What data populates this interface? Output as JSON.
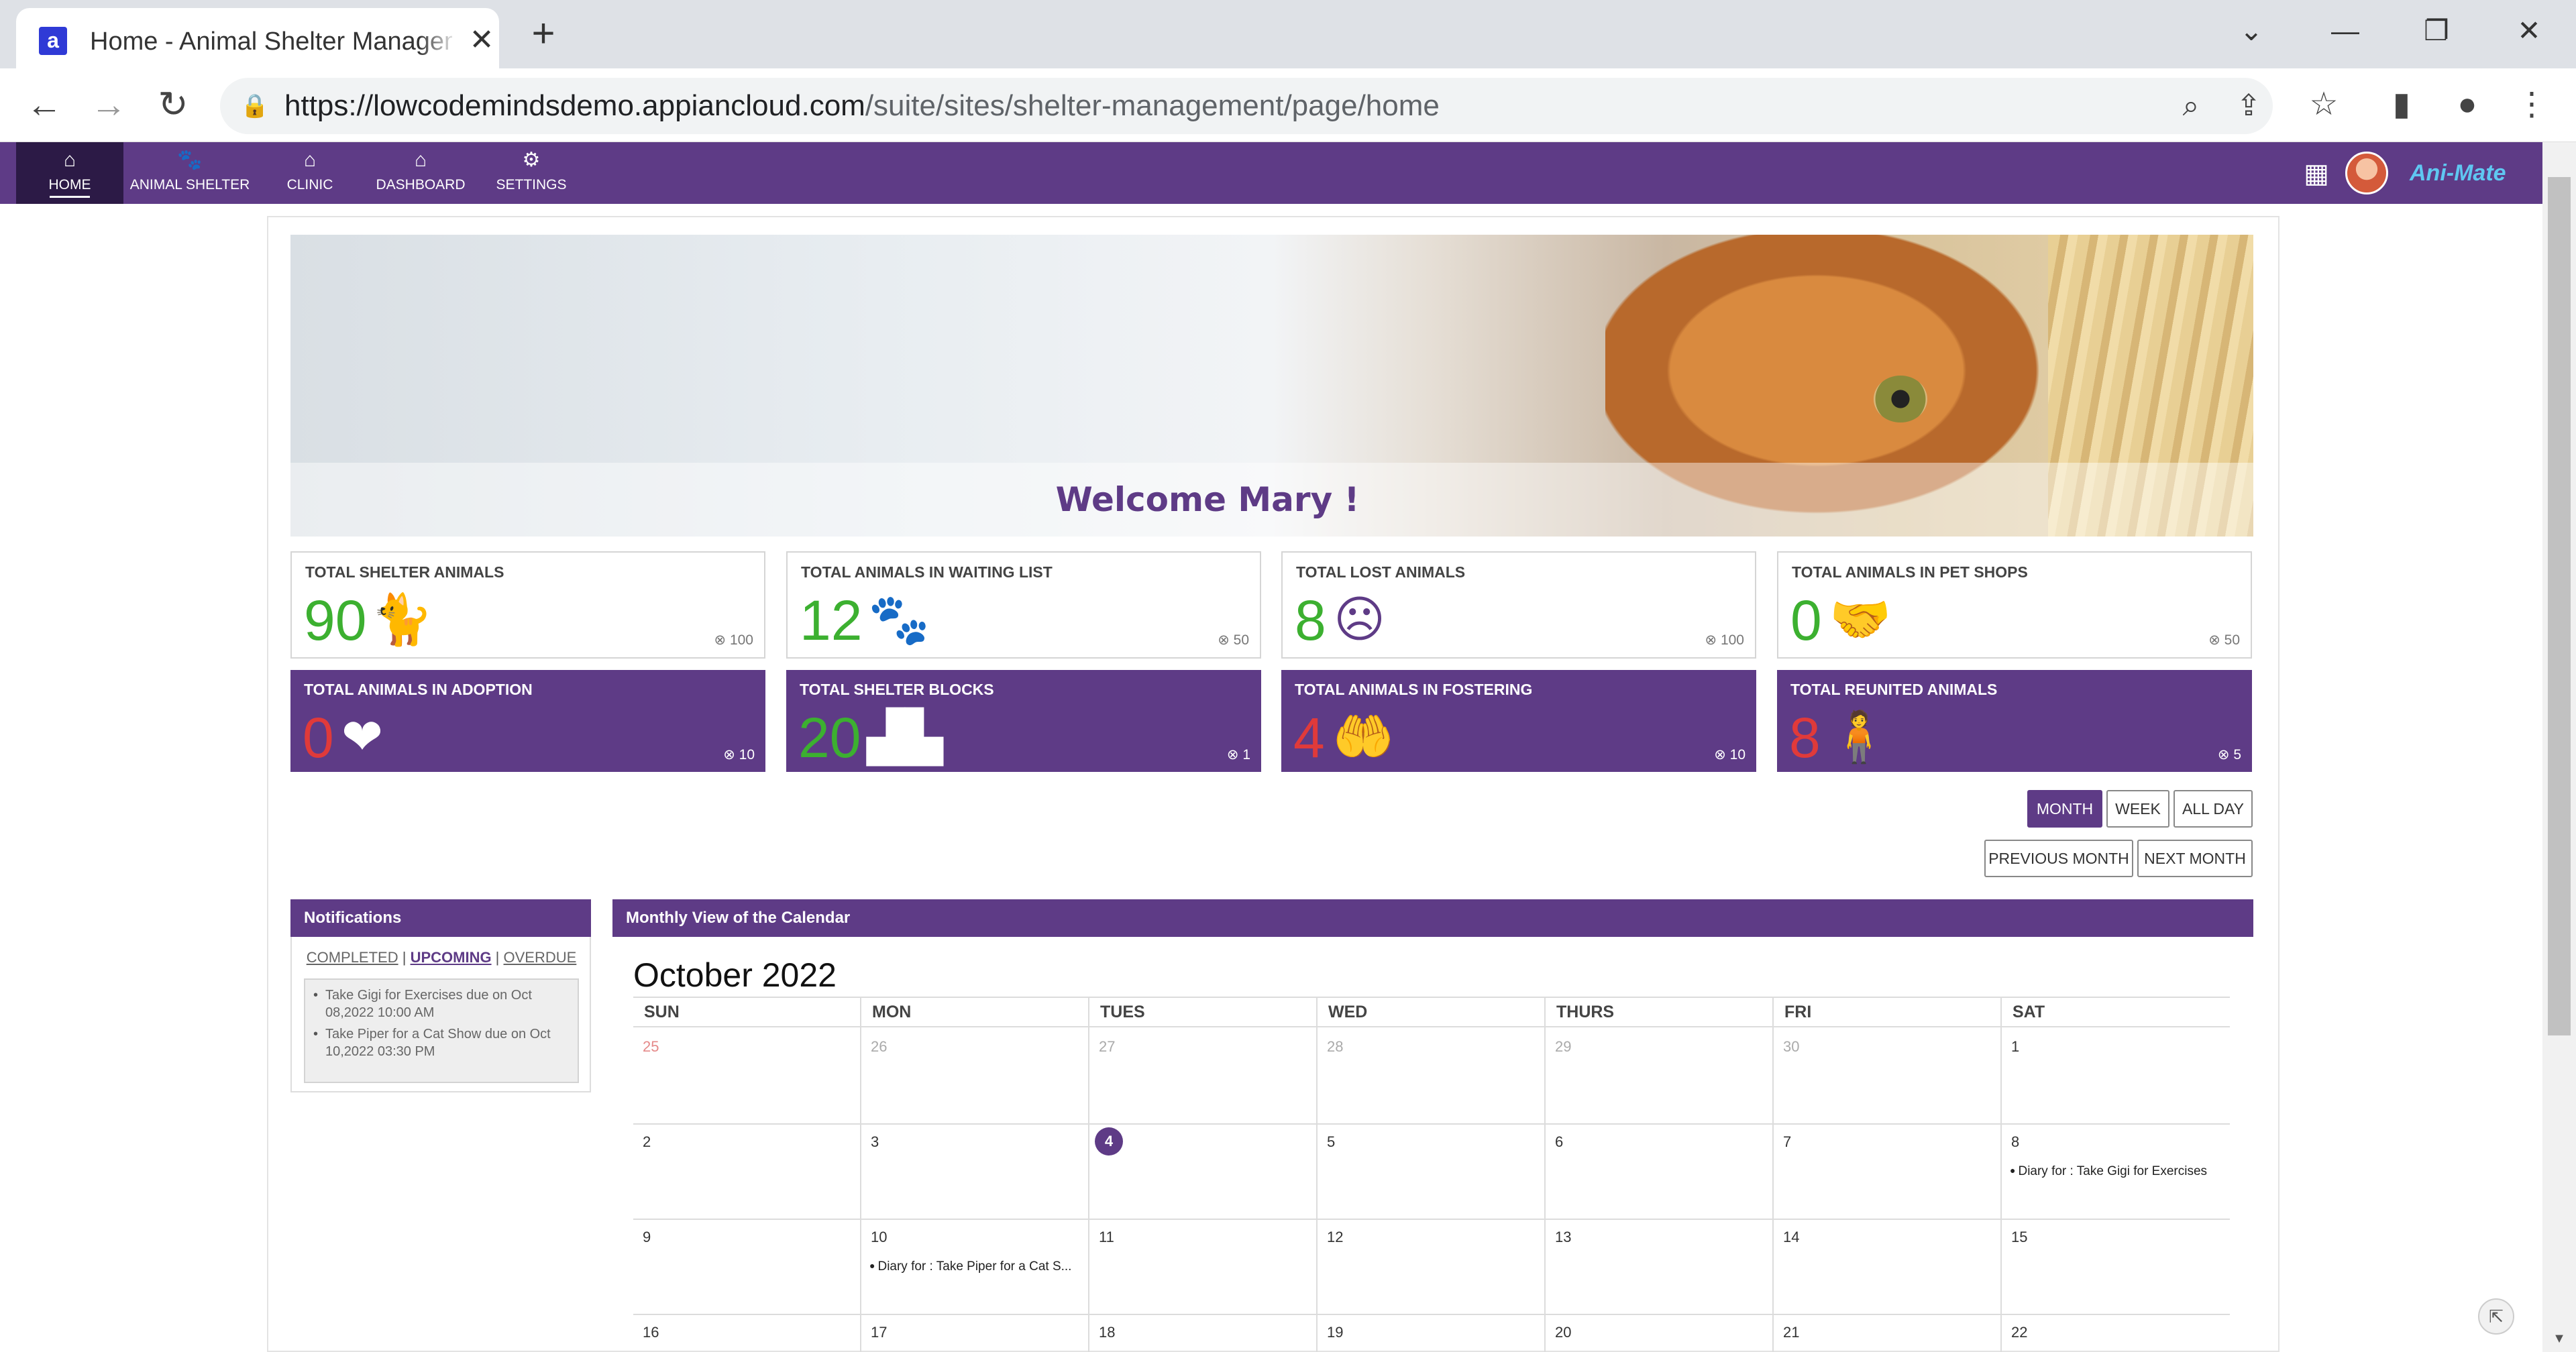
{
  "browser": {
    "tab_title": "Home - Animal Shelter Management",
    "tab_favicon": "a",
    "url_host": "https://lowcodemindsdemo.appiancloud.com",
    "url_path": "/suite/sites/shelter-management/page/home"
  },
  "appnav": {
    "items": [
      {
        "label": "HOME",
        "icon": "home-icon"
      },
      {
        "label": "ANIMAL SHELTER",
        "icon": "paw-icon"
      },
      {
        "label": "CLINIC",
        "icon": "clinic-icon"
      },
      {
        "label": "DASHBOARD",
        "icon": "dashboard-icon"
      },
      {
        "label": "SETTINGS",
        "icon": "gear-icon"
      }
    ],
    "active": "HOME",
    "brand": "Ani-Mate"
  },
  "banner": {
    "welcome": "Welcome Mary !"
  },
  "tiles": [
    {
      "label": "TOTAL SHELTER ANIMALS",
      "value": "90",
      "target": "100",
      "icon": "cat-icon",
      "style": "light",
      "value_color": "#3cb030"
    },
    {
      "label": "TOTAL ANIMALS IN WAITING LIST",
      "value": "12",
      "target": "50",
      "icon": "paw-icon",
      "style": "light",
      "value_color": "#3cb030"
    },
    {
      "label": "TOTAL LOST ANIMALS",
      "value": "8",
      "target": "100",
      "icon": "sad-face-icon",
      "style": "light",
      "value_color": "#3cb030"
    },
    {
      "label": "TOTAL ANIMALS IN PET SHOPS",
      "value": "0",
      "target": "50",
      "icon": "handshake-icon",
      "style": "light",
      "value_color": "#3cb030"
    },
    {
      "label": "TOTAL ANIMALS IN ADOPTION",
      "value": "0",
      "target": "10",
      "icon": "heart-hand-icon",
      "style": "dark",
      "value_color": "#e03a3a"
    },
    {
      "label": "TOTAL SHELTER BLOCKS",
      "value": "20",
      "target": "1",
      "icon": "blocks-icon",
      "style": "dark",
      "value_color": "#3cb030"
    },
    {
      "label": "TOTAL ANIMALS IN FOSTERING",
      "value": "4",
      "target": "10",
      "icon": "hands-icon",
      "style": "dark",
      "value_color": "#e03a3a"
    },
    {
      "label": "TOTAL REUNITED ANIMALS",
      "value": "8",
      "target": "5",
      "icon": "person-icon",
      "style": "dark",
      "value_color": "#e03a3a"
    }
  ],
  "calendar_controls": {
    "view_buttons": [
      "MONTH",
      "WEEK",
      "ALL DAY"
    ],
    "selected_view": "MONTH",
    "prev": "PREVIOUS MONTH",
    "next": "NEXT MONTH"
  },
  "notifications": {
    "title": "Notifications",
    "filters": [
      "COMPLETED",
      "UPCOMING",
      "OVERDUE"
    ],
    "active_filter": "UPCOMING",
    "items": [
      "Take Gigi for Exercises due on Oct 08,2022 10:00 AM",
      "Take Piper for a Cat Show due on Oct 10,2022 03:30 PM"
    ]
  },
  "calendar": {
    "title": "Monthly View of the Calendar",
    "month_label": "October 2022",
    "days_of_week": [
      "SUN",
      "MON",
      "TUES",
      "WED",
      "THURS",
      "FRI",
      "SAT"
    ],
    "weeks": [
      [
        "25",
        "26",
        "27",
        "28",
        "29",
        "30",
        "1"
      ],
      [
        "2",
        "3",
        "4",
        "5",
        "6",
        "7",
        "8"
      ],
      [
        "9",
        "10",
        "11",
        "12",
        "13",
        "14",
        "15"
      ],
      [
        "16",
        "17",
        "18",
        "19",
        "20",
        "21",
        "22"
      ]
    ],
    "today": "4",
    "events": [
      {
        "day": "8",
        "text": "Diary for : Take Gigi for Exercises"
      },
      {
        "day": "10",
        "text": "Diary for : Take Piper for a Cat S..."
      }
    ]
  }
}
